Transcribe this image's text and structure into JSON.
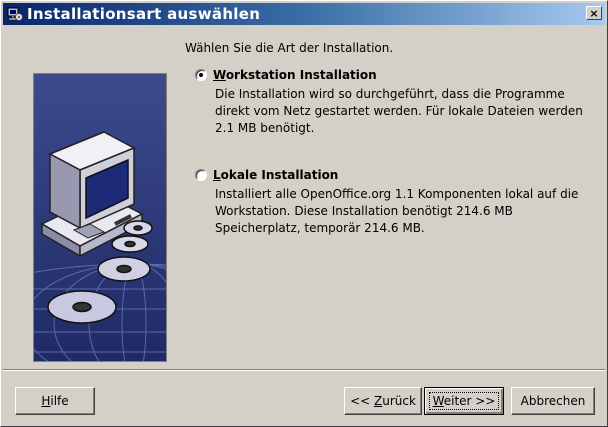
{
  "window": {
    "title": "Installationsart auswählen",
    "close_label": "×"
  },
  "intro": "Wählen Sie die Art der Installation.",
  "options": [
    {
      "label_mnemonic": "W",
      "label_rest": "orkstation Installation",
      "selected": true,
      "description": "Die Installation wird so durchgeführt, dass die Programme direkt vom Netz gestartet werden. Für lokale Dateien werden 2.1 MB benötigt."
    },
    {
      "label_mnemonic": "L",
      "label_rest": "okale Installation",
      "selected": false,
      "description": "Installiert alle OpenOffice.org 1.1 Komponenten lokal auf die Workstation. Diese Installation benötigt 214.6 MB Speicherplatz, temporär 214.6 MB."
    }
  ],
  "buttons": {
    "help_mnemonic": "H",
    "help_rest": "ilfe",
    "back_prefix": "<< ",
    "back_mnemonic": "Z",
    "back_rest": "urück",
    "next_mnemonic": "W",
    "next_rest": "eiter >>",
    "cancel": "Abbrechen"
  },
  "colors": {
    "titlebar_start": "#0a246a",
    "titlebar_end": "#a6caf0",
    "dialog_bg": "#d4d0c8",
    "art_bg": "#2f3c7e"
  },
  "icons": {
    "title": "setup-icon",
    "side": "computer-and-discs-illustration"
  }
}
